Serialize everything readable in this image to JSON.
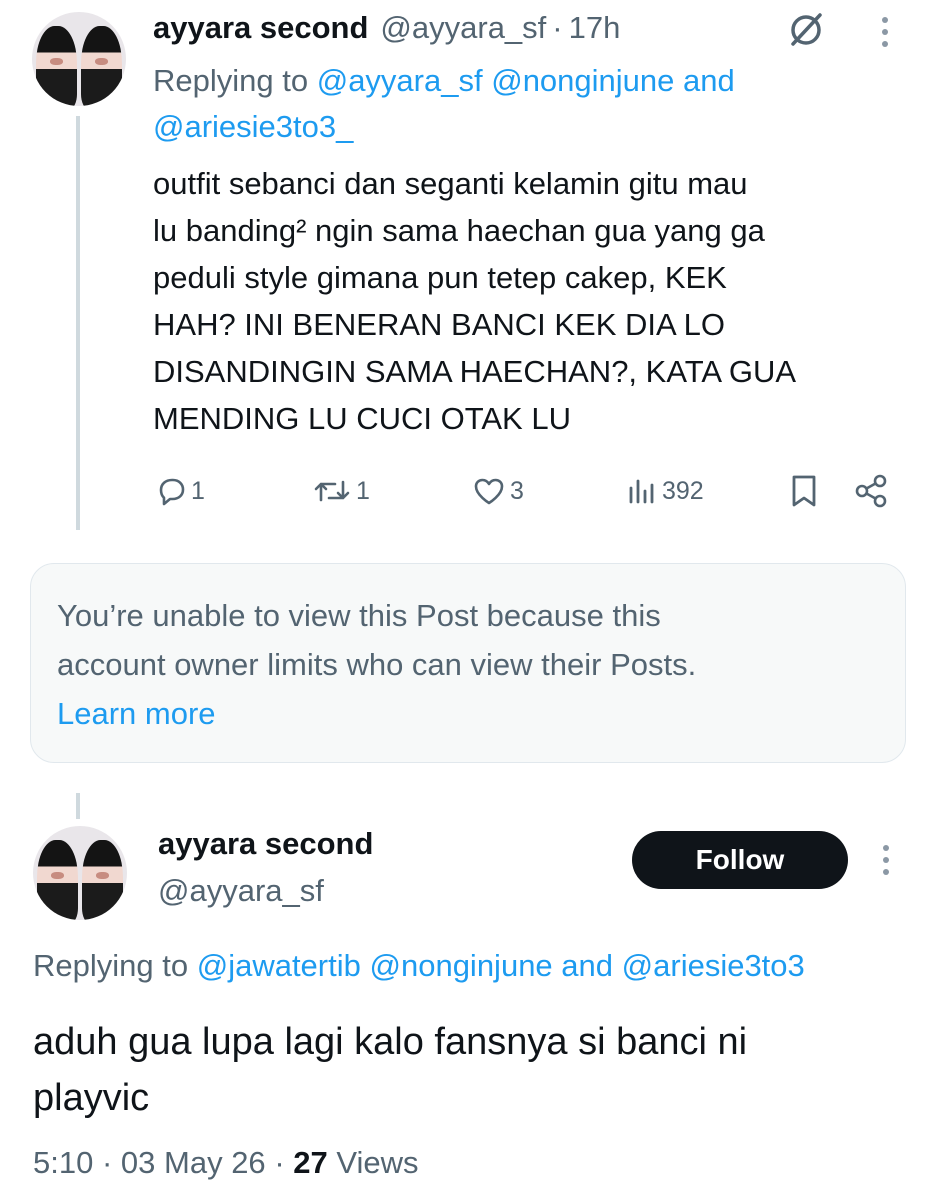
{
  "reply_tweet": {
    "display_name": "ayyara second",
    "handle": "@ayyara_sf",
    "separator": "·",
    "time_ago": "17h",
    "replying_prefix": "Replying to",
    "replying_handle_1": "@ayyara_sf",
    "replying_handle_2": "@nonginjune",
    "replying_and": "and",
    "replying_handle_3": "@ariesie3to3_",
    "text_lines": [
      "outfit sebanci dan seganti kelamin gitu mau",
      "lu banding² ngin sama haechan gua yang ga",
      "peduli style gimana pun tetep cakep, KEK",
      "HAH? INI BENERAN BANCI KEK DIA LO",
      "DISANDINGIN SAMA HAECHAN?, KATA GUA",
      "MENDING LU CUCI OTAK LU"
    ],
    "replies_count": "1",
    "reposts_count": "1",
    "likes_count": "3",
    "views_count": "392"
  },
  "unavailable_notice": {
    "line1": "You’re unable to view this Post because this",
    "line2": "account owner limits who can view their Posts.",
    "learn_more": "Learn more"
  },
  "main_tweet": {
    "display_name": "ayyara second",
    "handle": "@ayyara_sf",
    "follow_label": "Follow",
    "replying_prefix": "Replying to",
    "replying_handle_1": "@jawatertib",
    "replying_handle_2": "@nonginjune",
    "replying_and": "and",
    "replying_handle_3": "@ariesie3to3",
    "text_line1": "aduh gua lupa lagi kalo fansnya si banci ni",
    "text_line2": "playvic",
    "time": "5:10",
    "date": "03 May 26",
    "separator": "·",
    "views_count": "27",
    "views_label": "Views"
  },
  "colors": {
    "link": "#1d9bf0",
    "muted": "#536471",
    "text": "#0f1419",
    "thread_line": "#cfd9de",
    "notice_bg": "#f7f9f9"
  },
  "icons": [
    "grok-icon",
    "more-icon",
    "reply-icon",
    "repost-icon",
    "like-icon",
    "views-icon",
    "bookmark-icon",
    "share-icon"
  ]
}
